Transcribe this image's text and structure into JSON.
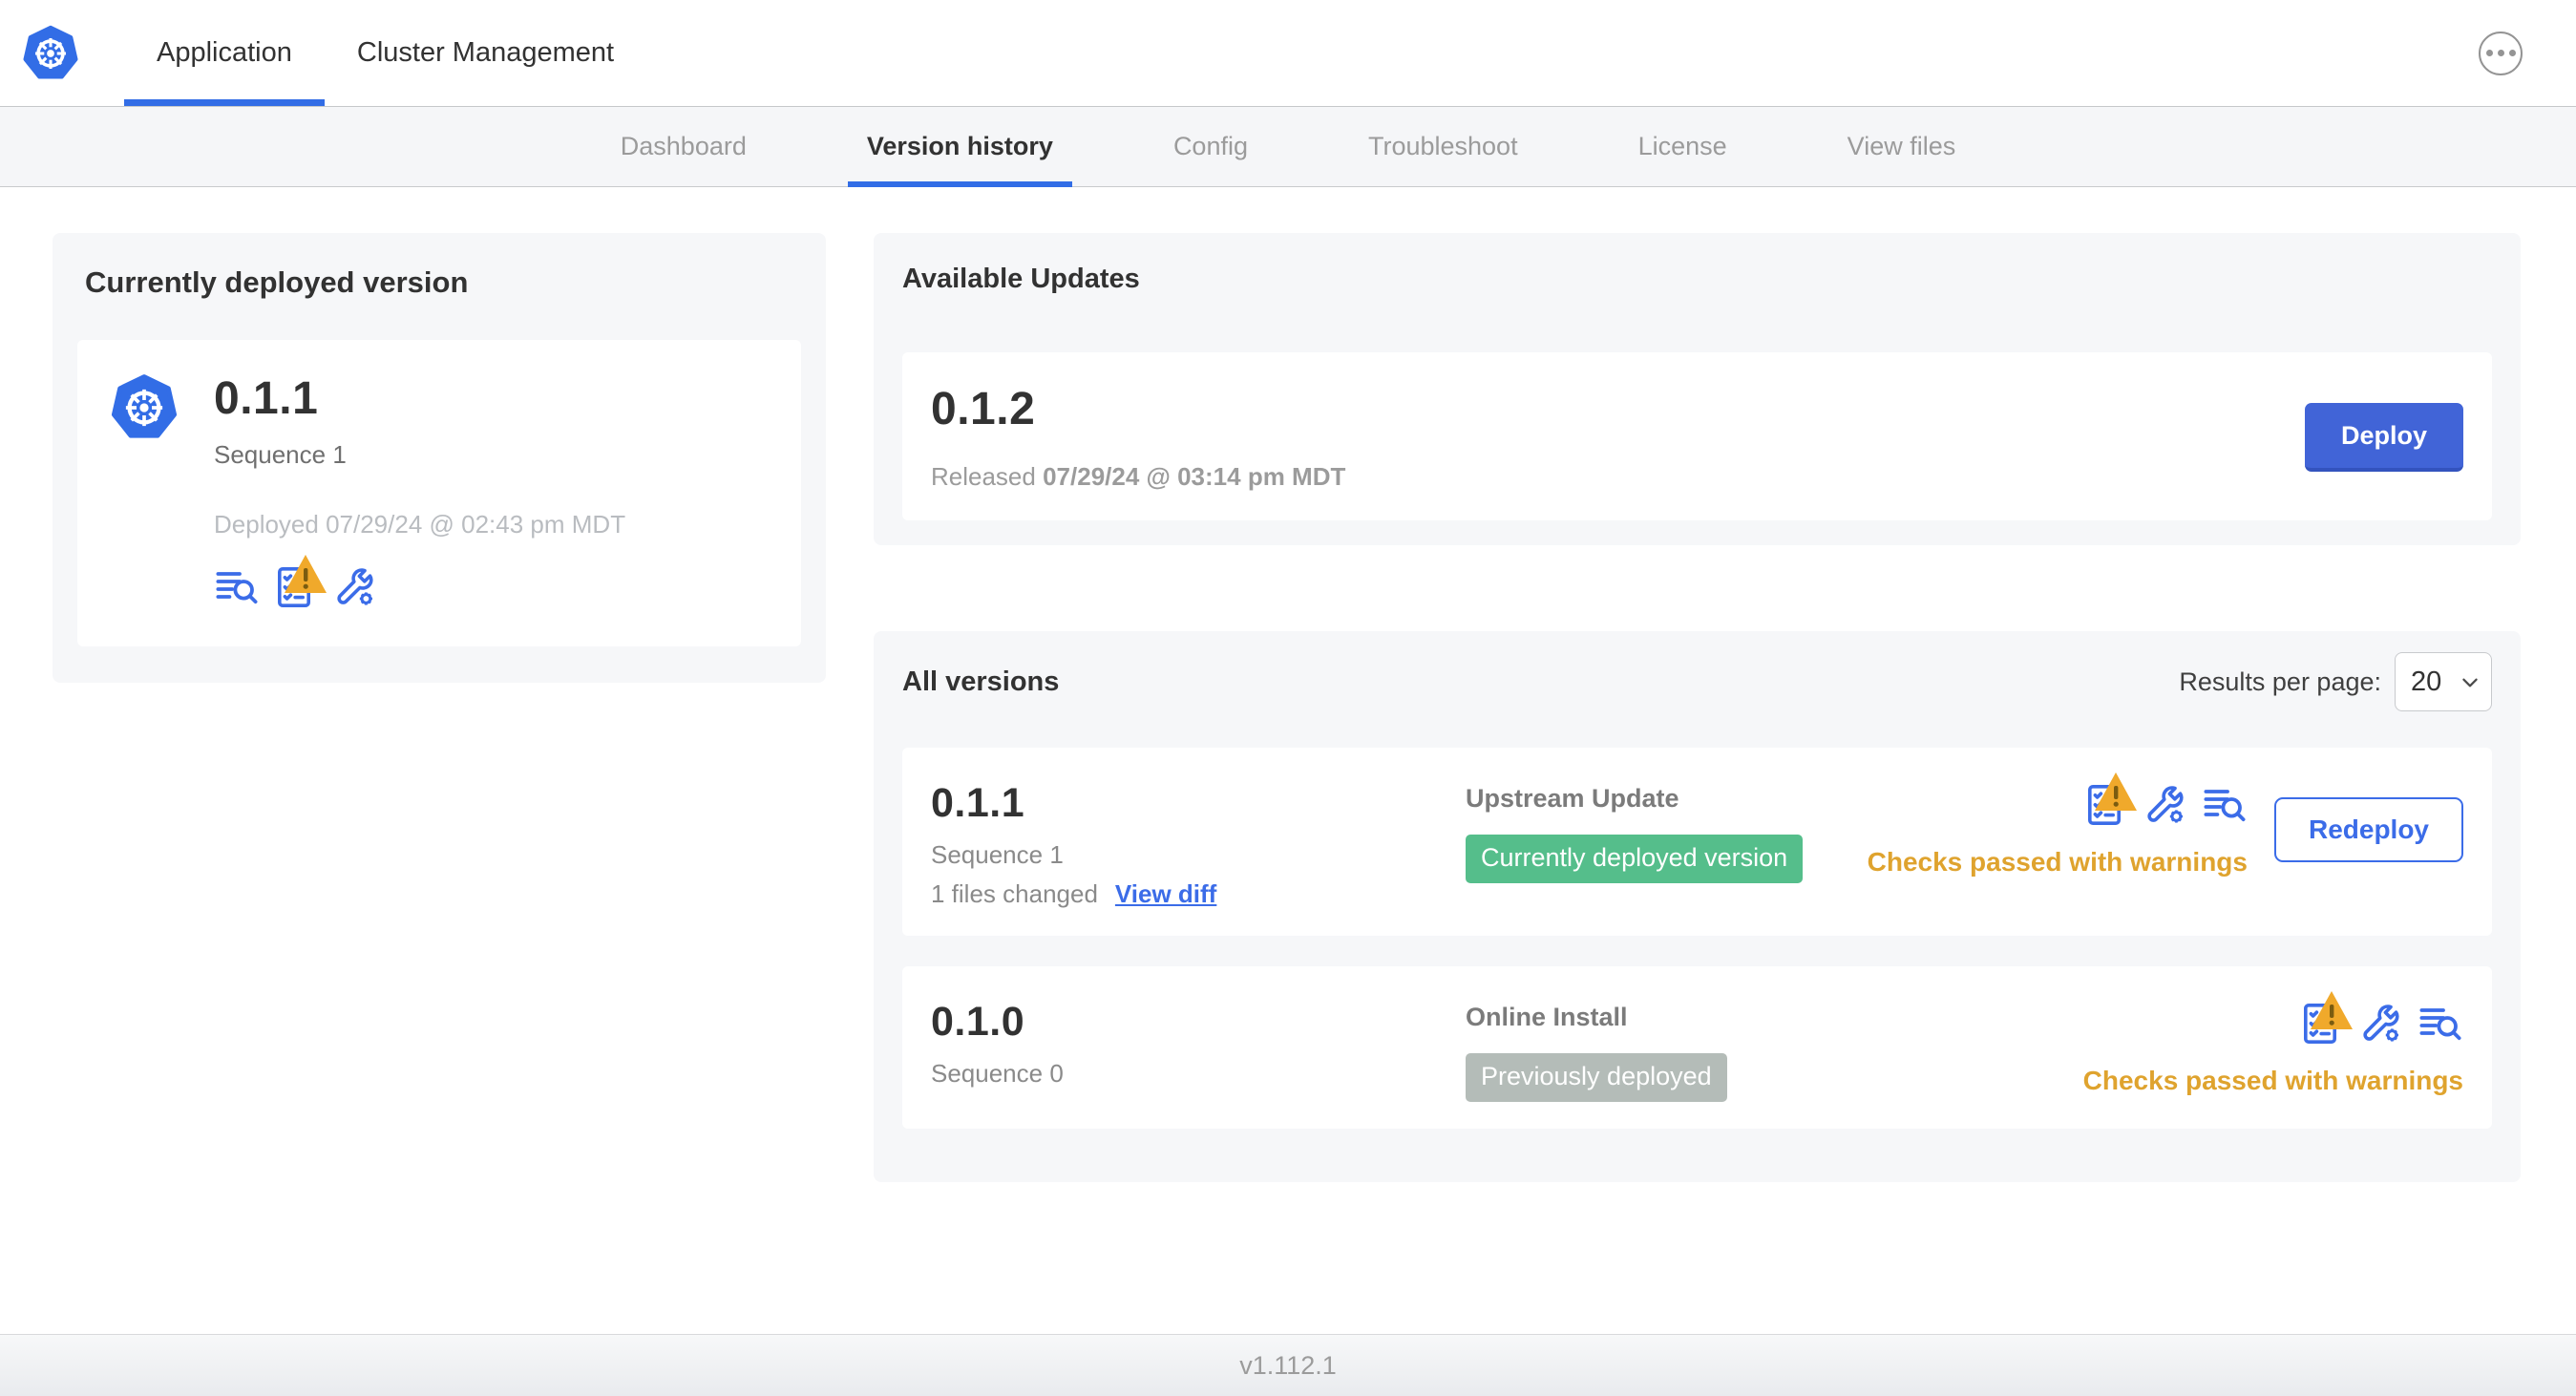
{
  "header": {
    "logo": "kubernetes-logo",
    "tabs": [
      {
        "label": "Application",
        "active": true
      },
      {
        "label": "Cluster Management",
        "active": false
      }
    ],
    "more_menu_icon": "ellipsis-icon"
  },
  "subnav": {
    "tabs": [
      {
        "label": "Dashboard",
        "active": false
      },
      {
        "label": "Version history",
        "active": true
      },
      {
        "label": "Config",
        "active": false
      },
      {
        "label": "Troubleshoot",
        "active": false
      },
      {
        "label": "License",
        "active": false
      },
      {
        "label": "View files",
        "active": false
      }
    ]
  },
  "current_version": {
    "title": "Currently deployed version",
    "version": "0.1.1",
    "sequence": "Sequence 1",
    "deployed": "Deployed 07/29/24 @ 02:43 pm MDT",
    "icons": [
      "deploy-logs-icon",
      "preflight-checks-warning-icon",
      "edit-config-icon"
    ]
  },
  "available_updates": {
    "title": "Available Updates",
    "version": "0.1.2",
    "released_prefix": "Released",
    "released_date": "07/29/24 @ 03:14 pm MDT",
    "deploy_label": "Deploy"
  },
  "all_versions": {
    "title": "All versions",
    "results_per_page_label": "Results per page:",
    "results_per_page_value": "20",
    "rows": [
      {
        "version": "0.1.1",
        "sequence": "Sequence 1",
        "files_changed": "1 files changed",
        "diff_link": "View diff",
        "source": "Upstream Update",
        "badge": "Currently deployed version",
        "badge_type": "success",
        "status": "Checks passed with warnings",
        "action_label": "Redeploy",
        "icons": [
          "preflight-checks-warning-icon",
          "edit-config-icon",
          "deploy-logs-icon"
        ]
      },
      {
        "version": "0.1.0",
        "sequence": "Sequence 0",
        "source": "Online Install",
        "badge": "Previously deployed",
        "badge_type": "muted",
        "status": "Checks passed with warnings",
        "icons": [
          "preflight-checks-warning-icon",
          "edit-config-icon",
          "deploy-logs-icon"
        ]
      }
    ]
  },
  "footer": {
    "app_version": "v1.112.1"
  },
  "colors": {
    "accent_blue": "#326de6",
    "link_blue": "#3b6ce8",
    "primary_button": "#4164d7",
    "success_badge": "#55be8b",
    "muted_badge": "#b4bcb8",
    "warning_text": "#dfa32e",
    "warning_triangle": "#f0a92b",
    "panel_bg": "#f6f7f9"
  }
}
